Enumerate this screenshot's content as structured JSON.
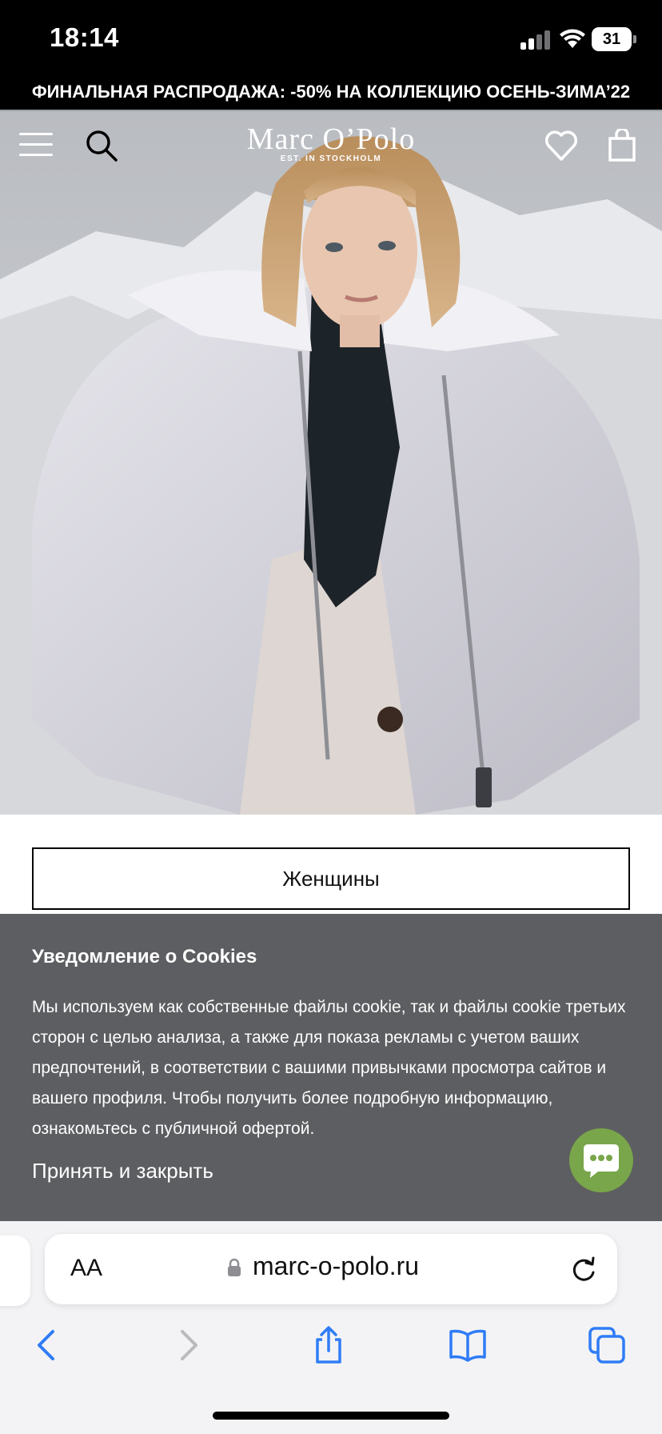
{
  "status_bar": {
    "time": "18:14",
    "battery_level": "31"
  },
  "promo_banner": {
    "text": "ФИНАЛЬНАЯ РАСПРОДАЖА: -50% НА КОЛЛЕКЦИЮ ОСЕНЬ-ЗИМА’22"
  },
  "header": {
    "logo_main": "Marc O’Polo",
    "logo_sub": "EST. IN STOCKHOLM",
    "icons": [
      "menu-icon",
      "search-icon",
      "heart-icon",
      "bag-icon"
    ]
  },
  "hero": {
    "category_button": "Женщины"
  },
  "cookie_notice": {
    "title": "Уведомление о Cookies",
    "body": "Мы используем как собственные файлы cookie, так и файлы cookie третьих сторон с целью анализа, а также для показа рекламы с учетом ваших предпочтений, в соответствии с вашими привычками просмотра сайтов и вашего профиля. Чтобы получить более подробную информацию, ознакомьтесь с публичной офертой.",
    "accept_label": "Принять и закрыть"
  },
  "safari": {
    "text_size_label": "AA",
    "url": "marc-o-polo.ru",
    "toolbar_icons": [
      "back-icon",
      "forward-icon",
      "share-icon",
      "bookmarks-icon",
      "tabs-icon"
    ]
  },
  "colors": {
    "chat_button": "#79a64a",
    "cookie_panel": "#5d5e61",
    "safari_blue": "#2f7cf6"
  }
}
